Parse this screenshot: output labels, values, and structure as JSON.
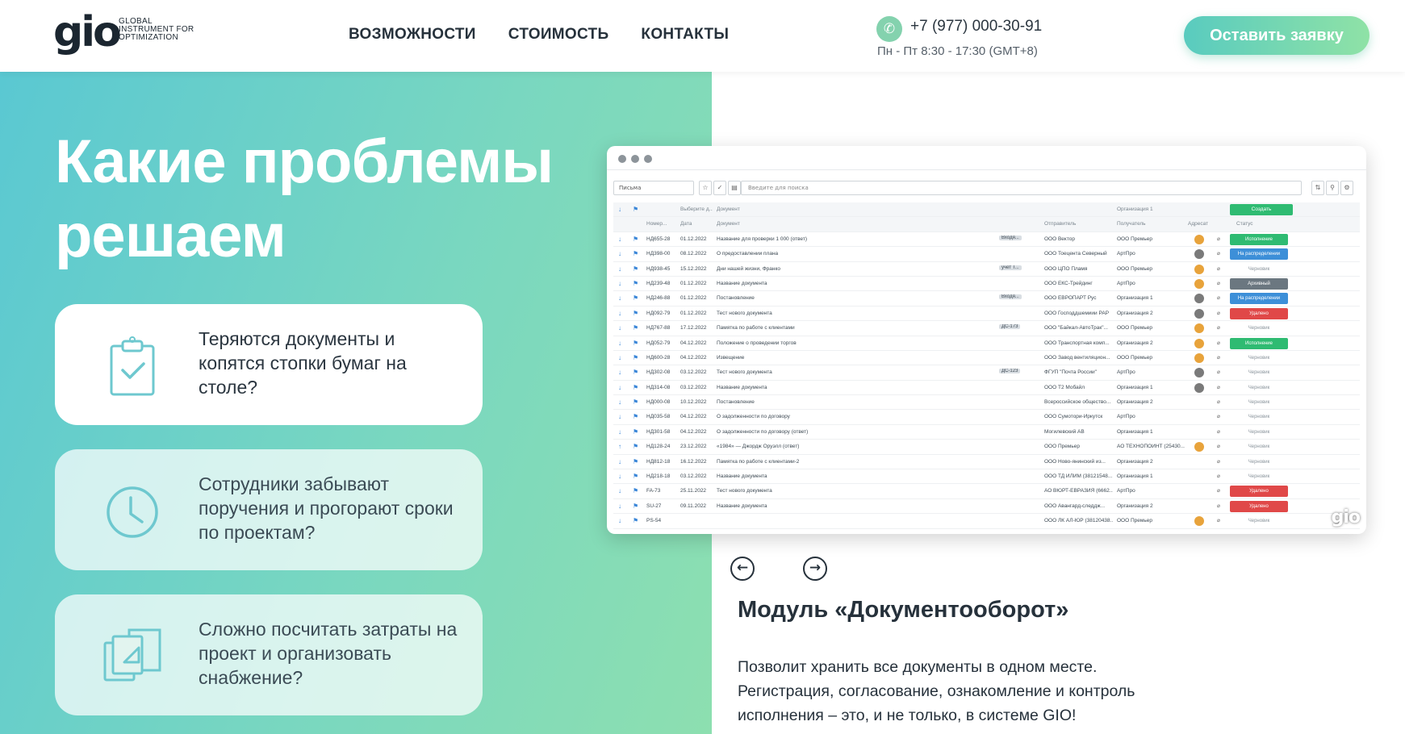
{
  "header": {
    "logo_mark": "gio",
    "logo_lines": [
      "GLOBAL",
      "INSTRUMENT FOR",
      "OPTIMIZATION"
    ],
    "nav": [
      "ВОЗМОЖНОСТИ",
      "СТОИМОСТЬ",
      "КОНТАКТЫ"
    ],
    "phone": "+7 (977) 000-30-91",
    "hours": "Пн - Пт 8:30 - 17:30 (GMT+8)",
    "cta_label": "Оставить заявку"
  },
  "hero": {
    "title": "Какие проблемы решаем",
    "cards": [
      {
        "text": "Теряются документы и копятся стопки бумаг на столе?",
        "icon": "clipboard-check-icon"
      },
      {
        "text": "Сотрудники забывают поручения и прогорают сроки по проектам?",
        "icon": "clock-icon"
      },
      {
        "text": "Сложно посчитать затраты на проект и организовать снабжение?",
        "icon": "documents-icon"
      }
    ]
  },
  "app": {
    "select_value": "Письма",
    "search_placeholder": "Введите для поиска",
    "filter_row": {
      "executor": "Выберите д...",
      "document": "Документ",
      "org": "Организация 1",
      "create": "Создать"
    },
    "columns": {
      "num": "Номер...",
      "date": "Дата",
      "doc": "Документ",
      "from": "Отправитель",
      "to": "Получатель",
      "addressee": "Адресат",
      "status": "Статус"
    },
    "rows": [
      {
        "num": "НД655-28",
        "date": "01.12.2022",
        "doc": "Название для проверки 1 000 (ответ)",
        "tag": "Входя...",
        "from": "ООО Вектор",
        "to": "ООО Премьер",
        "status": "Исполнение",
        "sc": "#2fbb72",
        "av": "#e8a33b"
      },
      {
        "num": "НД398-00",
        "date": "08.12.2022",
        "doc": "О предоставлении плана",
        "tag": "",
        "from": "ООО Тоецента Северный",
        "to": "АртПро",
        "status": "На распределении",
        "sc": "#3d8fd8",
        "av": "#7a7a7a"
      },
      {
        "num": "НД938-45",
        "date": "15.12.2022",
        "doc": "Дни нашей жизни, Франко",
        "tag": "учет Т...",
        "from": "ООО ЦПО Пламя",
        "to": "ООО Премьер",
        "status": "Черновик",
        "sc": "",
        "av": "#e8a33b"
      },
      {
        "num": "НД239-48",
        "date": "01.12.2022",
        "doc": "Название документа",
        "tag": "",
        "from": "ООО ЕКС-Трейдинг",
        "to": "АртПро",
        "status": "Архивный",
        "sc": "#6b7780",
        "av": "#e8a33b"
      },
      {
        "num": "НД246-88",
        "date": "01.12.2022",
        "doc": "Постановление",
        "tag": "Входя...",
        "from": "ООО ЕВРОПАРТ Рус",
        "to": "Организация 1",
        "status": "На распределении",
        "sc": "#3d8fd8",
        "av": "#7a7a7a"
      },
      {
        "num": "НД092-79",
        "date": "01.12.2022",
        "doc": "Тест нового документа",
        "tag": "",
        "from": "ООО Господдшемиии РАР",
        "to": "Организация 2",
        "status": "Удалено",
        "sc": "#e04848",
        "av": "#7a7a7a"
      },
      {
        "num": "НД767-88",
        "date": "17.12.2022",
        "doc": "Памятка по работе с клиентами",
        "tag": "ДС-173",
        "from": "ООО \"Байкал-АвтоТрак\"...",
        "to": "ООО Премьер",
        "status": "Черновик",
        "sc": "",
        "av": "#e8a33b"
      },
      {
        "num": "НД052-79",
        "date": "04.12.2022",
        "doc": "Положение о проведении торгов",
        "tag": "",
        "from": "ООО Транспортная комп...",
        "to": "Организация 2",
        "status": "Исполнение",
        "sc": "#2fbb72",
        "av": "#e8a33b"
      },
      {
        "num": "НД600-28",
        "date": "04.12.2022",
        "doc": "Извещение",
        "tag": "",
        "from": "ООО Завод вентиляцион...",
        "to": "ООО Премьер",
        "status": "Черновик",
        "sc": "",
        "av": "#e8a33b"
      },
      {
        "num": "НД302-08",
        "date": "03.12.2022",
        "doc": "Тест нового документа",
        "tag": "ДС-123",
        "from": "ФГУП \"Почта России\"",
        "to": "АртПро",
        "status": "Черновик",
        "sc": "",
        "av": "#7a7a7a"
      },
      {
        "num": "НД314-08",
        "date": "03.12.2022",
        "doc": "Название документа",
        "tag": "",
        "from": "ООО Т2 Мобайл",
        "to": "Организация 1",
        "status": "Черновик",
        "sc": "",
        "av": "#7a7a7a"
      },
      {
        "num": "НД000-08",
        "date": "10.12.2022",
        "doc": "Постановление",
        "tag": "",
        "from": "Всероссийское общество...",
        "to": "Организация 2",
        "status": "Черновик",
        "sc": "",
        "av": ""
      },
      {
        "num": "НД035-58",
        "date": "04.12.2022",
        "doc": "О задолженности по договору",
        "tag": "",
        "from": "ООО Сумотори-Иркутск",
        "to": "АртПро",
        "status": "Черновик",
        "sc": "",
        "av": ""
      },
      {
        "num": "НД301-58",
        "date": "04.12.2022",
        "doc": "О задолженности по договору (ответ)",
        "tag": "",
        "from": "Могилевский АВ",
        "to": "Организация 1",
        "status": "Черновик",
        "sc": "",
        "av": ""
      },
      {
        "num": "НД128-24",
        "date": "23.12.2022",
        "doc": "«1984» — Джордж Оруэлл (ответ)",
        "tag": "",
        "from": "ООО Премьер",
        "to": "АО ТЕХНОПОИНТ (25430...",
        "status": "Черновик",
        "sc": "",
        "av": "#e8a33b"
      },
      {
        "num": "НД812-18",
        "date": "16.12.2022",
        "doc": "Памятка по работе с клиентами-2",
        "tag": "",
        "from": "ООО Ново-янинский из...",
        "to": "Организация 2",
        "status": "Черновик",
        "sc": "",
        "av": ""
      },
      {
        "num": "НД218-18",
        "date": "03.12.2022",
        "doc": "Название документа",
        "tag": "",
        "from": "ООО ТД ИЛИМ (38121548...",
        "to": "Организация 1",
        "status": "Черновик",
        "sc": "",
        "av": ""
      },
      {
        "num": "FA-73",
        "date": "25.11.2022",
        "doc": "Тест нового документа",
        "tag": "",
        "from": "АО ВЮРТ-ЕВРАЗИЯ (6662...",
        "to": "АртПро",
        "status": "Удалено",
        "sc": "#e04848",
        "av": ""
      },
      {
        "num": "SU-27",
        "date": "09.11.2022",
        "doc": "Название документа",
        "tag": "",
        "from": "ООО Авангард-следдж...",
        "to": "Организация 2",
        "status": "Удалено",
        "sc": "#e04848",
        "av": ""
      },
      {
        "num": "PS-54",
        "date": "",
        "doc": "",
        "tag": "",
        "from": "ООО ЛК АЛ-ЮР (38120438...",
        "to": "ООО Премьер",
        "status": "Черновик",
        "sc": "",
        "av": "#e8a33b"
      }
    ],
    "watermark": "gio"
  },
  "module": {
    "prev_label": "←",
    "next_label": "→",
    "title": "Модуль «Документооборот»",
    "description": "Позволит хранить все документы в одном месте. Регистрация, согласование, ознакомление и контроль исполнения – это, и не только, в системе GIO!"
  },
  "colors": {
    "accent_from": "#5ac8d2",
    "accent_to": "#8ddfb0",
    "text": "#26313b"
  }
}
